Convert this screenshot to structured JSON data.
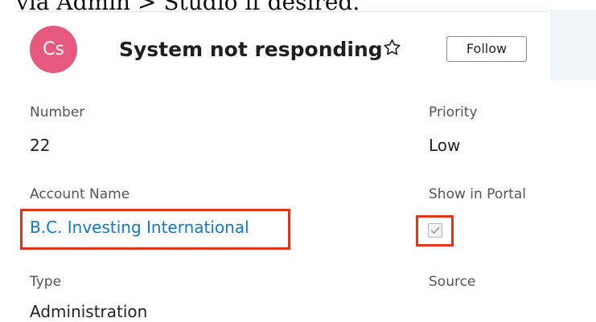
{
  "caption": "via Admin > Studio if desired.",
  "avatar": {
    "initials": "Cs",
    "color": "#e6597f"
  },
  "record": {
    "title": "System not responding",
    "star_icon": "star-outline-icon",
    "follow_label": "Follow"
  },
  "fields": {
    "number": {
      "label": "Number",
      "value": "22"
    },
    "priority": {
      "label": "Priority",
      "value": "Low"
    },
    "account_name": {
      "label": "Account Name",
      "value": "B.C. Investing International"
    },
    "show_in_portal": {
      "label": "Show in Portal",
      "checked": true
    },
    "type": {
      "label": "Type",
      "value": "Administration"
    },
    "source": {
      "label": "Source",
      "value": ""
    }
  },
  "colors": {
    "link": "#0c78d1",
    "highlight": "#e3331d"
  }
}
